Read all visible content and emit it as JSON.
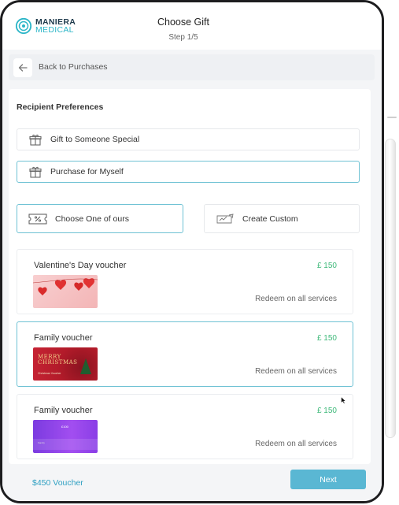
{
  "header": {
    "logo_line1": "MANIERA",
    "logo_line2": "MEDICAL",
    "title": "Choose Gift",
    "step": "Step 1/5"
  },
  "back": {
    "label": "Back to Purchases",
    "icon": "arrow-left-icon"
  },
  "recipient": {
    "title": "Recipient Preferences",
    "options": [
      {
        "label": "Gift to Someone Special",
        "icon": "gift-icon",
        "selected": false
      },
      {
        "label": "Purchase for Myself",
        "icon": "gift-icon",
        "selected": true
      }
    ]
  },
  "choices": [
    {
      "label": "Choose One of ours",
      "icon": "voucher-percent-icon",
      "selected": true
    },
    {
      "label": "Create Custom",
      "icon": "custom-voucher-icon",
      "selected": false
    }
  ],
  "vouchers": [
    {
      "name": "Valentine's Day voucher",
      "price": "£ 150",
      "redeem": "Redeem on all services",
      "selected": false,
      "image": {
        "theme": "valentine-hearts"
      }
    },
    {
      "name": "Family voucher",
      "price": "£ 150",
      "redeem": "Redeem on all services",
      "selected": true,
      "image": {
        "theme": "christmas",
        "line1": "MERRY",
        "line2": "CHRISTMAS",
        "sub": "Christmas Voucher"
      }
    },
    {
      "name": "Family voucher",
      "price": "£ 150",
      "redeem": "Redeem on all services",
      "selected": false,
      "image": {
        "theme": "purple-card",
        "amount": "£100",
        "caption": "Family"
      }
    }
  ],
  "footer": {
    "total": "$450 Voucher",
    "next_label": "Next"
  },
  "colors": {
    "accent": "#5ab7d3",
    "selected_border": "#6fc2d4",
    "price": "#3fb97a",
    "logo_teal": "#2bb5c7"
  }
}
